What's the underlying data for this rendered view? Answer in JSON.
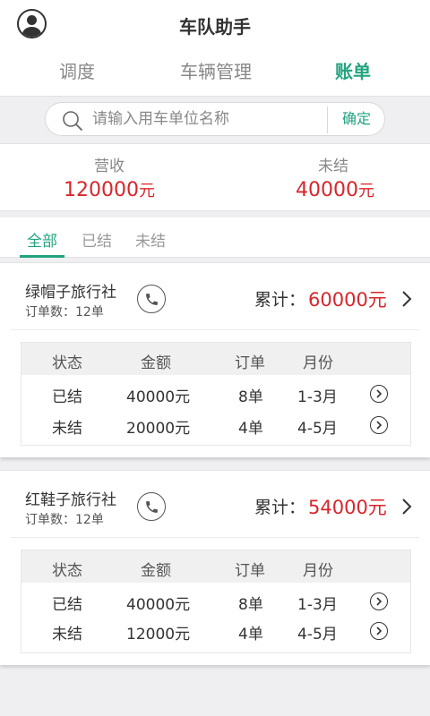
{
  "app": {
    "title": "车队助手"
  },
  "tabs": [
    {
      "label": "调度"
    },
    {
      "label": "车辆管理"
    },
    {
      "label": "账单"
    }
  ],
  "search": {
    "placeholder": "请输入用车单位名称",
    "value": "",
    "confirm_label": "确定"
  },
  "summary": {
    "revenue_label": "营收",
    "revenue_value": "120000",
    "unsettled_label": "未结",
    "unsettled_value": "40000",
    "unit": "元"
  },
  "filters": [
    {
      "label": "全部"
    },
    {
      "label": "已结"
    },
    {
      "label": "未结"
    }
  ],
  "table_headers": {
    "status": "状态",
    "amount": "金额",
    "orders": "订单",
    "month": "月份"
  },
  "agencies": [
    {
      "name": "绿帽子旅行社",
      "order_count": "订单数：12单",
      "total_label": "累计：",
      "total_value": "60000元",
      "rows": [
        {
          "status": "已结",
          "amount": "40000元",
          "orders": "8单",
          "month": "1-3月"
        },
        {
          "status": "未结",
          "amount": "20000元",
          "orders": "4单",
          "month": "4-5月"
        }
      ]
    },
    {
      "name": "红鞋子旅行社",
      "order_count": "订单数：12单",
      "total_label": "累计：",
      "total_value": "54000元",
      "rows": [
        {
          "status": "已结",
          "amount": "40000元",
          "orders": "8单",
          "month": "1-3月"
        },
        {
          "status": "未结",
          "amount": "12000元",
          "orders": "4单",
          "month": "4-5月"
        }
      ]
    }
  ],
  "colors": {
    "accent": "#23a37f",
    "money": "#d9252b"
  },
  "icons": {
    "avatar": "user-avatar-icon",
    "search": "search-icon",
    "phone": "phone-icon",
    "chevron": "chevron-right-icon",
    "row_detail": "circle-chevron-right-icon"
  }
}
